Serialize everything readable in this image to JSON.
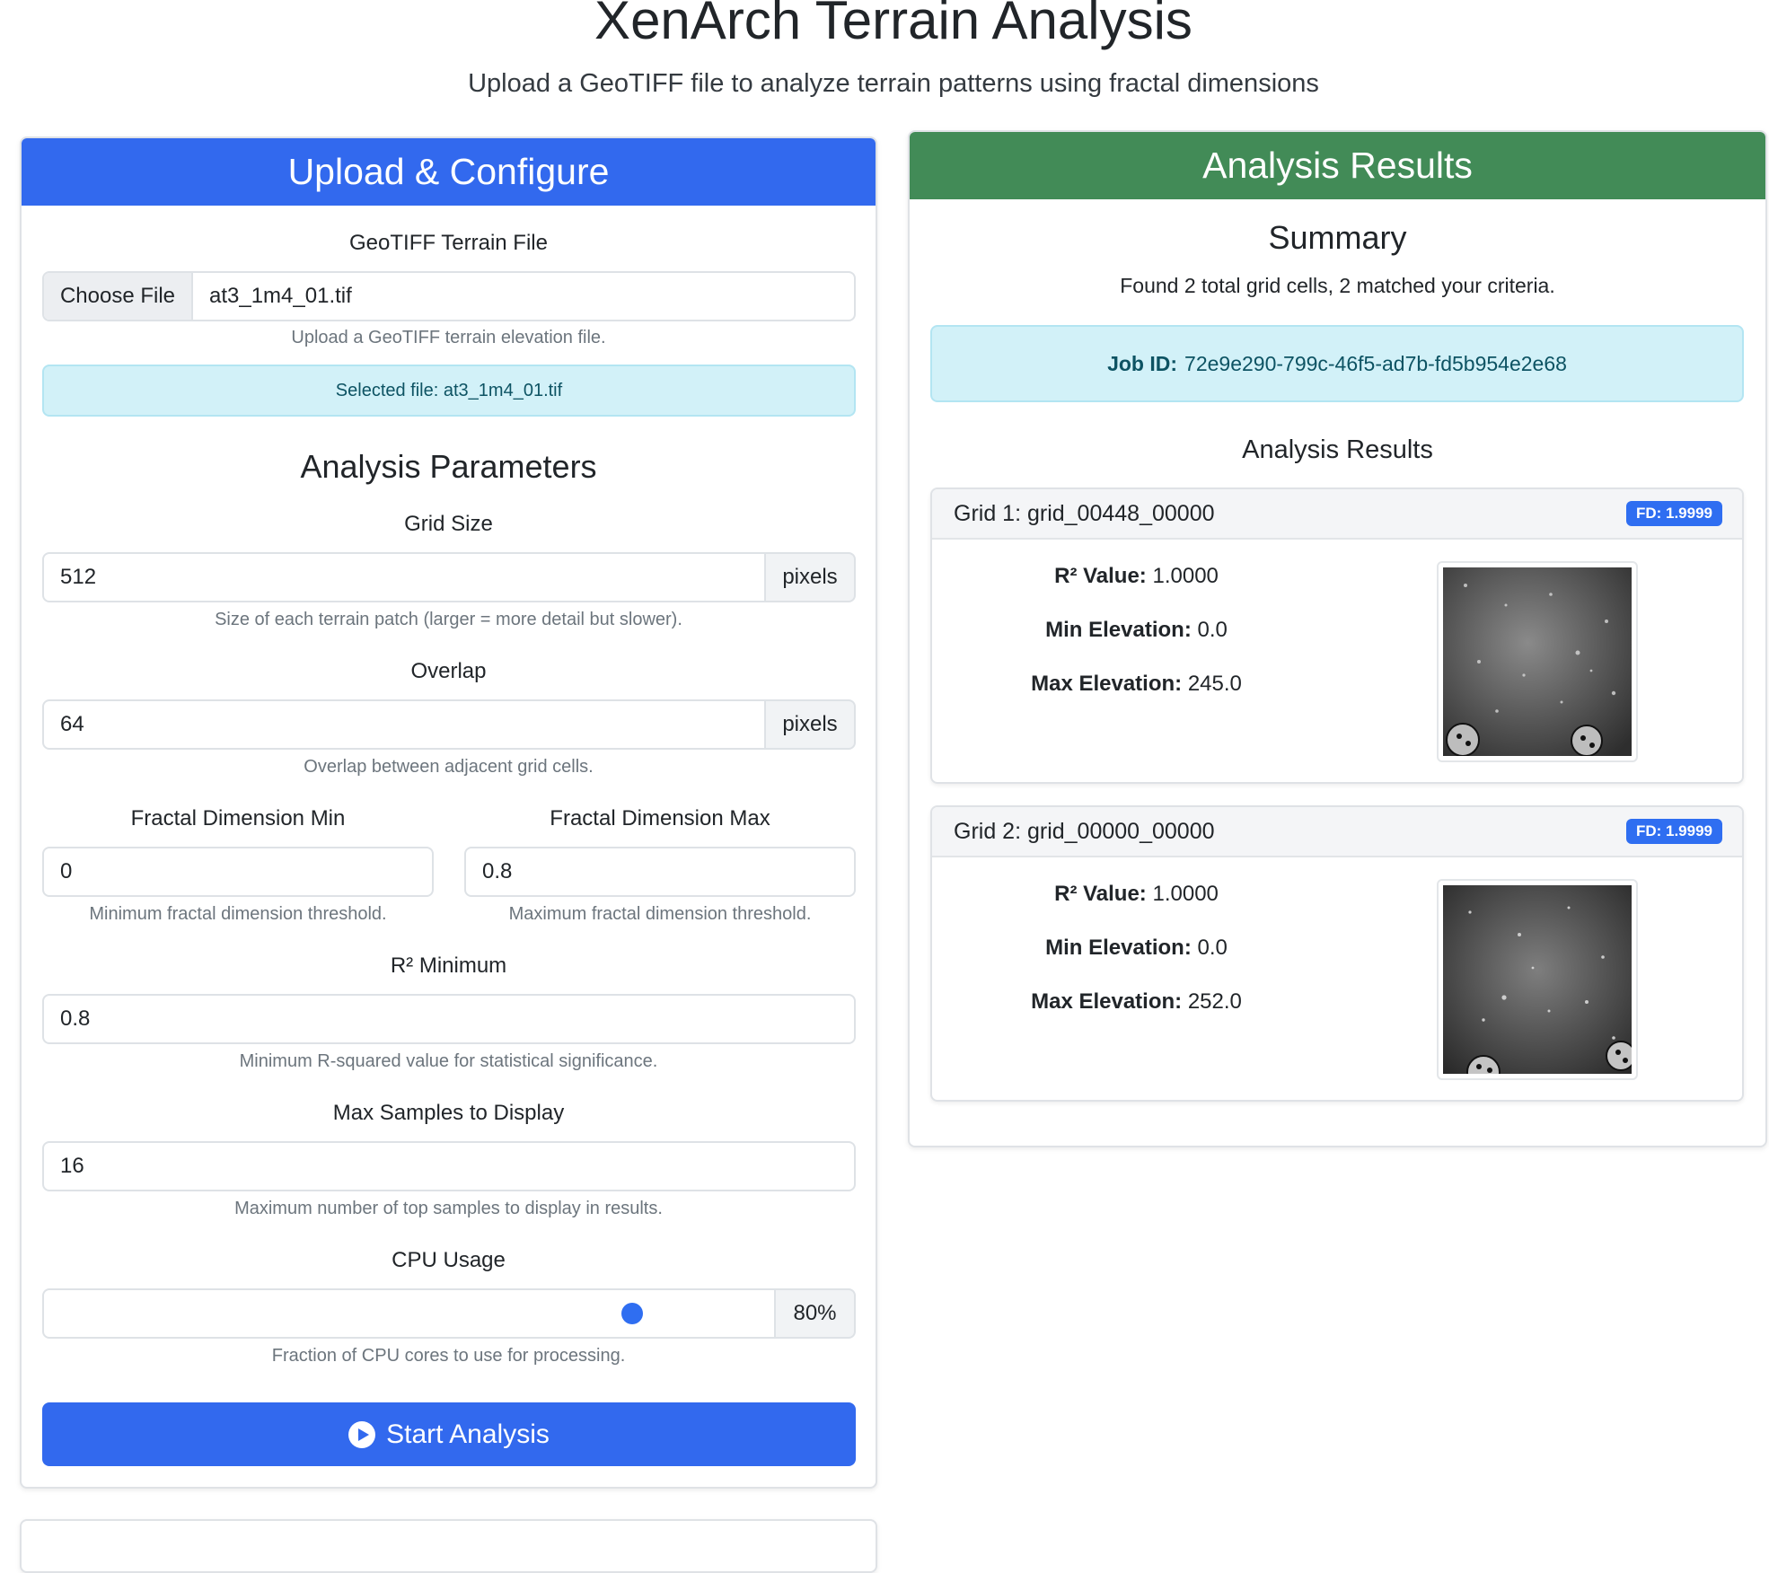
{
  "header": {
    "title": "XenArch Terrain Analysis",
    "subtitle": "Upload a GeoTIFF file to analyze terrain patterns using fractal dimensions"
  },
  "upload_card": {
    "header": "Upload & Configure",
    "file_label": "GeoTIFF Terrain File",
    "choose_file_label": "Choose File",
    "file_name": "at3_1m4_01.tif",
    "file_help": "Upload a GeoTIFF terrain elevation file.",
    "selected_file_text": "Selected file: at3_1m4_01.tif",
    "params_heading": "Analysis Parameters",
    "grid_size": {
      "label": "Grid Size",
      "value": "512",
      "unit": "pixels",
      "help": "Size of each terrain patch (larger = more detail but slower)."
    },
    "overlap": {
      "label": "Overlap",
      "value": "64",
      "unit": "pixels",
      "help": "Overlap between adjacent grid cells."
    },
    "fd_min": {
      "label": "Fractal Dimension Min",
      "value": "0",
      "help": "Minimum fractal dimension threshold."
    },
    "fd_max": {
      "label": "Fractal Dimension Max",
      "value": "0.8",
      "help": "Maximum fractal dimension threshold."
    },
    "r2_min": {
      "label": "R² Minimum",
      "value": "0.8",
      "help": "Minimum R-squared value for statistical significance."
    },
    "max_samples": {
      "label": "Max Samples to Display",
      "value": "16",
      "help": "Maximum number of top samples to display in results."
    },
    "cpu_usage": {
      "label": "CPU Usage",
      "value_text": "80%",
      "fraction": 0.8,
      "help": "Fraction of CPU cores to use for processing."
    },
    "start_button": "Start Analysis"
  },
  "results_card": {
    "header": "Analysis Results",
    "summary_heading": "Summary",
    "summary_text": "Found 2 total grid cells, 2 matched your criteria.",
    "job_id_label": "Job ID:",
    "job_id": "72e9e290-799c-46f5-ad7b-fd5b954e2e68",
    "results_heading": "Analysis Results",
    "labels": {
      "r2": "R² Value:",
      "min_elev": "Min Elevation:",
      "max_elev": "Max Elevation:"
    },
    "grids": [
      {
        "title": "Grid 1: grid_00448_00000",
        "fd_badge": "FD: 1.9999",
        "r2": "1.0000",
        "min_elev": "0.0",
        "max_elev": "245.0"
      },
      {
        "title": "Grid 2: grid_00000_00000",
        "fd_badge": "FD: 1.9999",
        "r2": "1.0000",
        "min_elev": "0.0",
        "max_elev": "252.0"
      }
    ]
  },
  "colors": {
    "primary": "#3269ee",
    "success": "#428b57",
    "info_bg": "#d2f1f8",
    "info_text": "#0d5363",
    "badge": "#2f6ef1"
  },
  "icons": {
    "start_button": "play-circle-icon"
  }
}
